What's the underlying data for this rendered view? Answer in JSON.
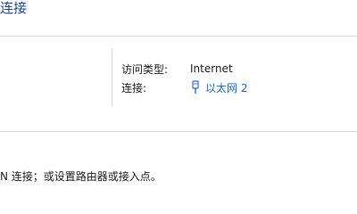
{
  "section_heading": "连接",
  "network_info": {
    "access_type_label": "访问类型:",
    "access_type_value": "Internet",
    "connection_label": "连接:",
    "connection_value": "以太网 2",
    "connection_icon": "ethernet-icon"
  },
  "bottom_text": "N 连接；或设置路由器或接入点。",
  "colors": {
    "link": "#1b6ac9",
    "heading": "#1f4e99",
    "divider": "#d9d9d9"
  }
}
